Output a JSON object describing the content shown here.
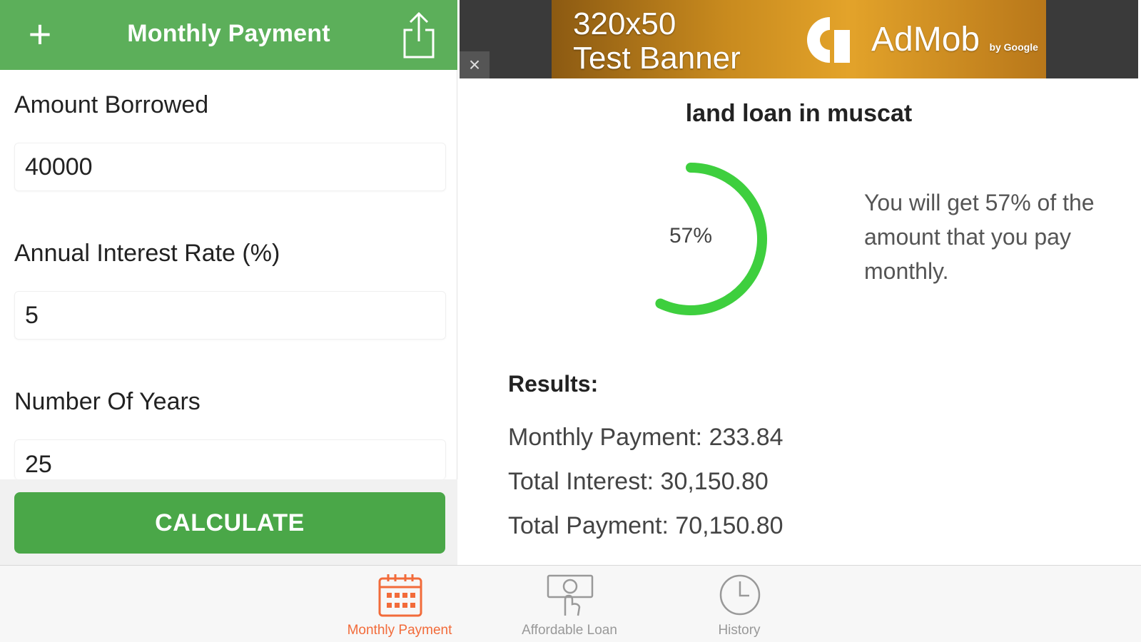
{
  "navbar": {
    "title": "Monthly Payment",
    "add_icon": "plus-icon",
    "share_icon": "share-icon",
    "color": "#5caf5a"
  },
  "form": {
    "amount_label": "Amount Borrowed",
    "amount_value": "40000",
    "rate_label": "Annual Interest Rate (%)",
    "rate_value": "5",
    "years_label": "Number Of Years",
    "years_value": "25",
    "calculate_label": "CALCULATE"
  },
  "ad": {
    "line1": "320x50",
    "line2": "Test Banner",
    "brand": "AdMob",
    "brand_by": "by Google",
    "close": "×"
  },
  "result": {
    "title": "land loan in muscat",
    "percent": 57,
    "percent_label": "57%",
    "note": "You will get 57% of the amount that you pay monthly.",
    "heading": "Results:",
    "monthly_payment": "Monthly Payment: 233.84",
    "total_interest": "Total Interest: 30,150.80",
    "total_payment": "Total Payment: 70,150.80",
    "gauge_color": "#3ecf3e"
  },
  "tabs": [
    {
      "label": "Monthly Payment",
      "icon": "calendar-icon",
      "active": true,
      "color": "#f26b3a"
    },
    {
      "label": "Affordable Loan",
      "icon": "hand-money-icon",
      "active": false,
      "color": "#999999"
    },
    {
      "label": "History",
      "icon": "clock-icon",
      "active": false,
      "color": "#999999"
    }
  ]
}
